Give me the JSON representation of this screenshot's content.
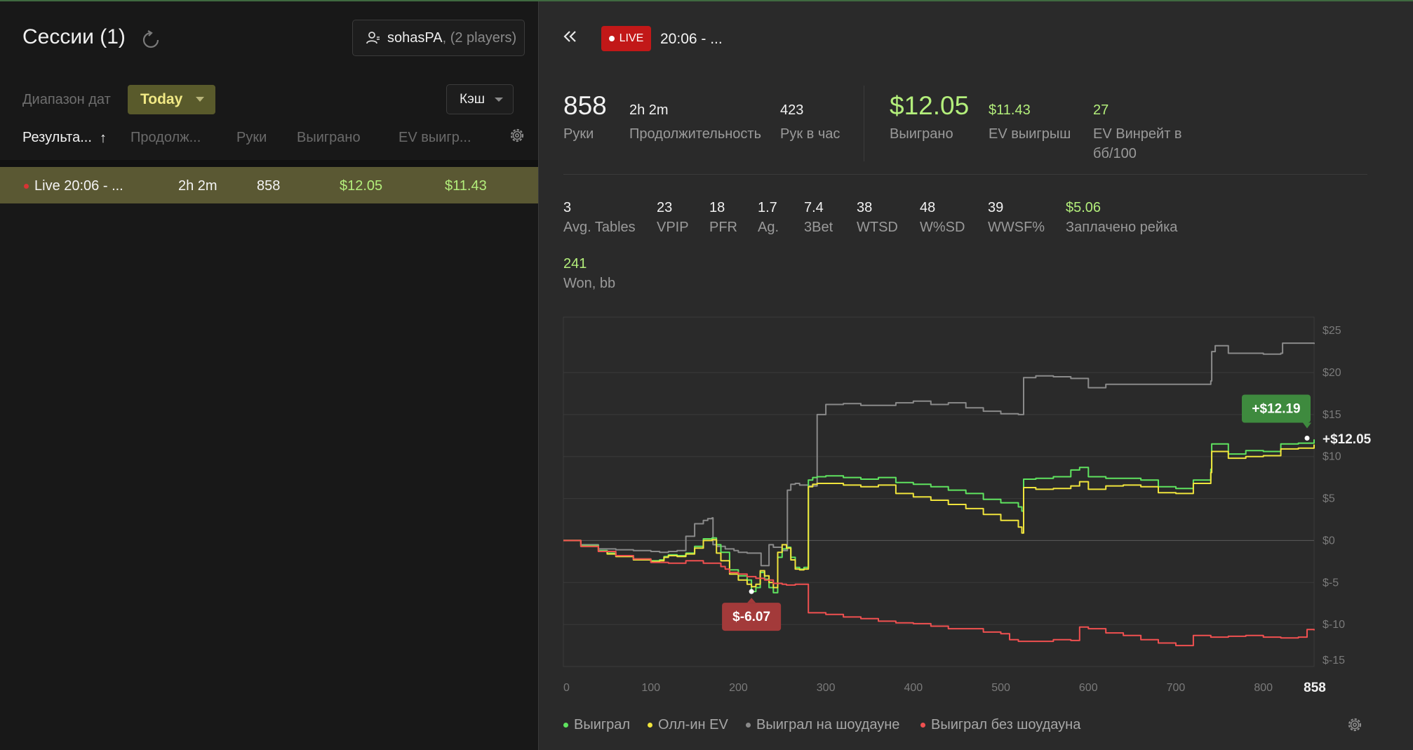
{
  "left": {
    "title": "Сессии (1)",
    "player": {
      "name": "sohasPA",
      "suffix": ", (2 players)"
    },
    "date_range_label": "Диапазон дат",
    "date_range_value": "Today",
    "game_type": "Кэш",
    "columns": [
      "Результа...",
      "Продолж...",
      "Руки",
      "Выиграно",
      "EV выигр..."
    ],
    "sort_arrow": "↑",
    "session": {
      "name": "Live 20:06 - ...",
      "duration": "2h 2m",
      "hands": "858",
      "won": "$12.05",
      "ev": "$11.43"
    }
  },
  "right": {
    "live_label": "LIVE",
    "session_title": "20:06 - ...",
    "summary": {
      "hands": {
        "value": "858",
        "label": "Руки"
      },
      "duration": {
        "value": "2h 2m",
        "label": "Продолжительность"
      },
      "hands_per_hour": {
        "value": "423",
        "label": "Рук в час"
      },
      "won": {
        "value": "$12.05",
        "label": "Выиграно"
      },
      "ev_won": {
        "value": "$11.43",
        "label": "EV выигрыш"
      },
      "ev_winrate": {
        "value": "27",
        "label_line1": "EV Винрейт в",
        "label_line2": "бб/100"
      }
    },
    "stats": [
      {
        "value": "3",
        "label": "Avg. Tables",
        "green": false
      },
      {
        "value": "23",
        "label": "VPIP",
        "green": false
      },
      {
        "value": "18",
        "label": "PFR",
        "green": false
      },
      {
        "value": "1.7",
        "label": "Ag.",
        "green": false
      },
      {
        "value": "7.4",
        "label": "3Bet",
        "green": false
      },
      {
        "value": "38",
        "label": "WTSD",
        "green": false
      },
      {
        "value": "48",
        "label": "W%SD",
        "green": false
      },
      {
        "value": "39",
        "label": "WWSF%",
        "green": false
      },
      {
        "value": "$5.06",
        "label": "Заплачено рейка",
        "green": true
      }
    ],
    "won_bb": {
      "value": "241",
      "label": "Won, bb"
    }
  },
  "chart_data": {
    "type": "line",
    "x_ticks": [
      "0",
      "100",
      "200",
      "300",
      "400",
      "500",
      "600",
      "700",
      "800"
    ],
    "x_end_label": "858",
    "y_ticks": [
      "$25",
      "$20",
      "$15",
      "$10",
      "$5",
      "$0",
      "$-5",
      "$-10",
      "$-15"
    ],
    "xlim": [
      0,
      858
    ],
    "ylim": [
      -15,
      25
    ],
    "grid": true,
    "end_label": "+$12.05",
    "max_callout": {
      "x": 850,
      "y": 12.19,
      "label": "+$12.19"
    },
    "min_callout": {
      "x": 215,
      "y": -6.07,
      "label": "$-6.07"
    },
    "series": [
      {
        "name": "Выиграл на шоудауне",
        "color": "#8a8a8a",
        "x": [
          0,
          20,
          40,
          60,
          80,
          100,
          110,
          120,
          130,
          140,
          150,
          160,
          165,
          170,
          171,
          175,
          185,
          190,
          195,
          200,
          210,
          220,
          225,
          226,
          235,
          240,
          250,
          255,
          256,
          260,
          265,
          270,
          275,
          280,
          290,
          300,
          320,
          340,
          360,
          380,
          400,
          420,
          440,
          460,
          480,
          500,
          520,
          524,
          526,
          540,
          560,
          580,
          600,
          620,
          640,
          660,
          680,
          700,
          720,
          740,
          741,
          745,
          760,
          780,
          800,
          820,
          822,
          840,
          858
        ],
        "y": [
          0,
          -0.5,
          -1,
          -1.1,
          -1.2,
          -1.3,
          -1.4,
          -1.3,
          -1.2,
          0.5,
          2,
          2.4,
          2.6,
          2.7,
          -0.5,
          -0.7,
          -1,
          -1,
          -1.2,
          -1.4,
          -1.5,
          -1.5,
          -1.5,
          -3,
          -0.5,
          -0.8,
          -1.2,
          -1.2,
          6,
          6.7,
          6.8,
          6.6,
          6.6,
          6.5,
          15,
          16.2,
          16.3,
          16.1,
          16.1,
          16.4,
          16.6,
          16.2,
          16.4,
          15.8,
          15.4,
          15.1,
          15,
          15,
          19.4,
          19.6,
          19.5,
          19.3,
          18.2,
          18.6,
          18.6,
          18.6,
          18.6,
          18.6,
          18.6,
          19,
          22.5,
          23.2,
          22.3,
          22.3,
          22.2,
          22.3,
          23.5,
          23.5,
          23.4
        ]
      },
      {
        "name": "Выиграл",
        "color": "#5fe35f",
        "x": [
          0,
          20,
          40,
          50,
          60,
          80,
          100,
          110,
          115,
          120,
          130,
          140,
          150,
          160,
          170,
          175,
          180,
          190,
          200,
          210,
          215,
          220,
          225,
          230,
          235,
          240,
          245,
          250,
          255,
          260,
          265,
          270,
          275,
          280,
          285,
          290,
          300,
          320,
          340,
          360,
          380,
          400,
          420,
          440,
          460,
          480,
          500,
          520,
          524,
          526,
          540,
          560,
          580,
          590,
          600,
          620,
          640,
          660,
          680,
          700,
          720,
          740,
          741,
          760,
          780,
          800,
          820,
          840,
          858
        ],
        "y": [
          0,
          -0.6,
          -1.2,
          -1.5,
          -1.8,
          -2.2,
          -2.4,
          -2.3,
          -1.9,
          -1.7,
          -1.8,
          -1.5,
          -0.7,
          0.2,
          0.3,
          -0.5,
          -1.4,
          -3.5,
          -4.2,
          -4.7,
          -6.07,
          -5.6,
          -3.8,
          -4.6,
          -5.6,
          -6.2,
          -2,
          -1,
          -0.8,
          -2,
          -3.2,
          -3.4,
          -3.2,
          7.2,
          7.5,
          7.6,
          7.7,
          7.5,
          7.3,
          7.5,
          6.9,
          6.7,
          6.4,
          6.0,
          5.6,
          4.9,
          4.5,
          4,
          3.5,
          7.3,
          7.4,
          7.6,
          8.4,
          8.7,
          7.6,
          7.4,
          7.4,
          7.2,
          6.4,
          6.2,
          7.2,
          8.5,
          11.5,
          10.3,
          10.7,
          10.6,
          11.5,
          11.6,
          12.05
        ]
      },
      {
        "name": "Олл-ин EV",
        "color": "#f0e43c",
        "x": [
          0,
          20,
          40,
          50,
          60,
          80,
          100,
          110,
          115,
          120,
          130,
          140,
          150,
          160,
          170,
          175,
          180,
          190,
          200,
          210,
          215,
          220,
          225,
          230,
          235,
          240,
          245,
          250,
          255,
          260,
          265,
          270,
          275,
          280,
          285,
          290,
          300,
          320,
          340,
          360,
          380,
          400,
          420,
          440,
          460,
          480,
          500,
          520,
          524,
          526,
          540,
          560,
          580,
          590,
          600,
          620,
          640,
          660,
          680,
          700,
          720,
          740,
          741,
          760,
          780,
          800,
          820,
          840,
          858
        ],
        "y": [
          0,
          -0.7,
          -1.3,
          -1.6,
          -1.9,
          -2.3,
          -2.5,
          -2.4,
          -2.0,
          -1.8,
          -1.9,
          -1.6,
          -0.9,
          0,
          0.1,
          -1.5,
          -2.4,
          -4.0,
          -4.7,
          -5.2,
          -5.5,
          -5.2,
          -3.6,
          -4.2,
          -5.0,
          -5.6,
          -1.4,
          -0.5,
          -0.9,
          -2.3,
          -3.4,
          -3.5,
          -3.4,
          6.4,
          6.7,
          6.8,
          6.8,
          6.6,
          6.4,
          6.6,
          5.6,
          5.2,
          4.8,
          4.3,
          3.8,
          3.1,
          2.4,
          1.6,
          0.9,
          6.3,
          6.1,
          6.2,
          6.5,
          7.0,
          6.1,
          6.5,
          6.6,
          6.4,
          5.7,
          5.6,
          6.8,
          8.1,
          10.6,
          9.8,
          10.0,
          10.1,
          10.9,
          11.0,
          11.43
        ]
      },
      {
        "name": "Выиграл без шоудауна",
        "color": "#f05050",
        "x": [
          0,
          20,
          40,
          60,
          80,
          100,
          120,
          140,
          160,
          180,
          185,
          190,
          200,
          210,
          220,
          230,
          240,
          250,
          255,
          260,
          265,
          270,
          280,
          300,
          320,
          340,
          360,
          380,
          400,
          420,
          440,
          460,
          480,
          500,
          510,
          520,
          540,
          560,
          580,
          590,
          600,
          620,
          640,
          660,
          680,
          700,
          720,
          740,
          760,
          780,
          800,
          820,
          840,
          850,
          858
        ],
        "y": [
          0,
          -0.7,
          -1.3,
          -1.8,
          -2.2,
          -2.6,
          -2.7,
          -2.4,
          -2.7,
          -3.1,
          -3.4,
          -3.8,
          -4.0,
          -4.3,
          -4.5,
          -4.7,
          -5.1,
          -5.2,
          -5.3,
          -5.3,
          -5.2,
          -5.2,
          -8.6,
          -8.8,
          -9.1,
          -9.3,
          -9.6,
          -9.8,
          -9.9,
          -10.2,
          -10.5,
          -10.5,
          -10.9,
          -11.1,
          -11.8,
          -12.0,
          -12.0,
          -11.8,
          -11.9,
          -10.3,
          -10.5,
          -11.0,
          -11.3,
          -11.8,
          -12.2,
          -12.5,
          -11.3,
          -11.5,
          -11.4,
          -11.3,
          -11.5,
          -11.6,
          -11.5,
          -10.6,
          -10.7
        ]
      }
    ]
  }
}
